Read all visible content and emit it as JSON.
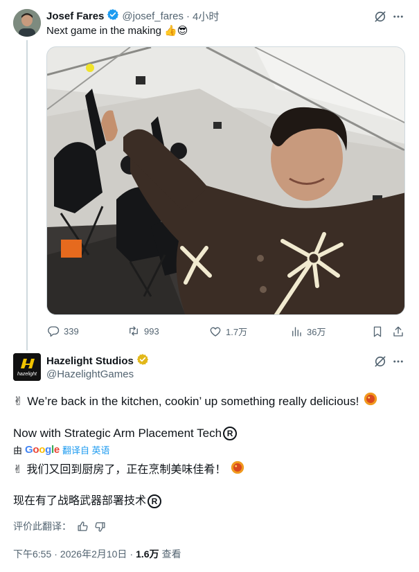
{
  "tweet1": {
    "author_name": "Josef Fares",
    "author_handle": "@josef_fares",
    "separator": "·",
    "time": "4小时",
    "text": "Next game in the making",
    "emoji": "👍😎",
    "stats": {
      "replies": "339",
      "retweets": "993",
      "likes": "1.7万",
      "views": "36万"
    }
  },
  "tweet2": {
    "author_name": "Hazelight Studios",
    "author_handle": "@HazelightGames",
    "logo_text": "hazelight",
    "line1": "We’re back in the kitchen, cookin’ up something really delicious!",
    "line2": "Now with Strategic Arm Placement Tech",
    "registered": "R",
    "translation": {
      "by": "由",
      "provider": "Google",
      "label": "翻译自 英语",
      "line1": "我们又回到厨房了，正在烹制美味佳肴！",
      "line2": "现在有了战略武器部署技术"
    },
    "rate_translation": "评价此翻译：",
    "meta": {
      "time": "下午6:55",
      "separator": "·",
      "date": "2026年2月10日",
      "views_count": "1.6万",
      "views_label": "查看"
    }
  },
  "colors": {
    "verified_blue": "#1d9bf0",
    "verified_gold": "#e2b719",
    "link_blue": "#1d9bf0",
    "text_muted": "#536471",
    "thread_line": "#cfd9de"
  },
  "icons": [
    "grok-icon",
    "more-icon",
    "reply-icon",
    "retweet-icon",
    "like-icon",
    "views-icon",
    "bookmark-icon",
    "share-icon",
    "thumbs-up-icon",
    "thumbs-down-icon",
    "victory-hand-icon",
    "food-icon"
  ]
}
